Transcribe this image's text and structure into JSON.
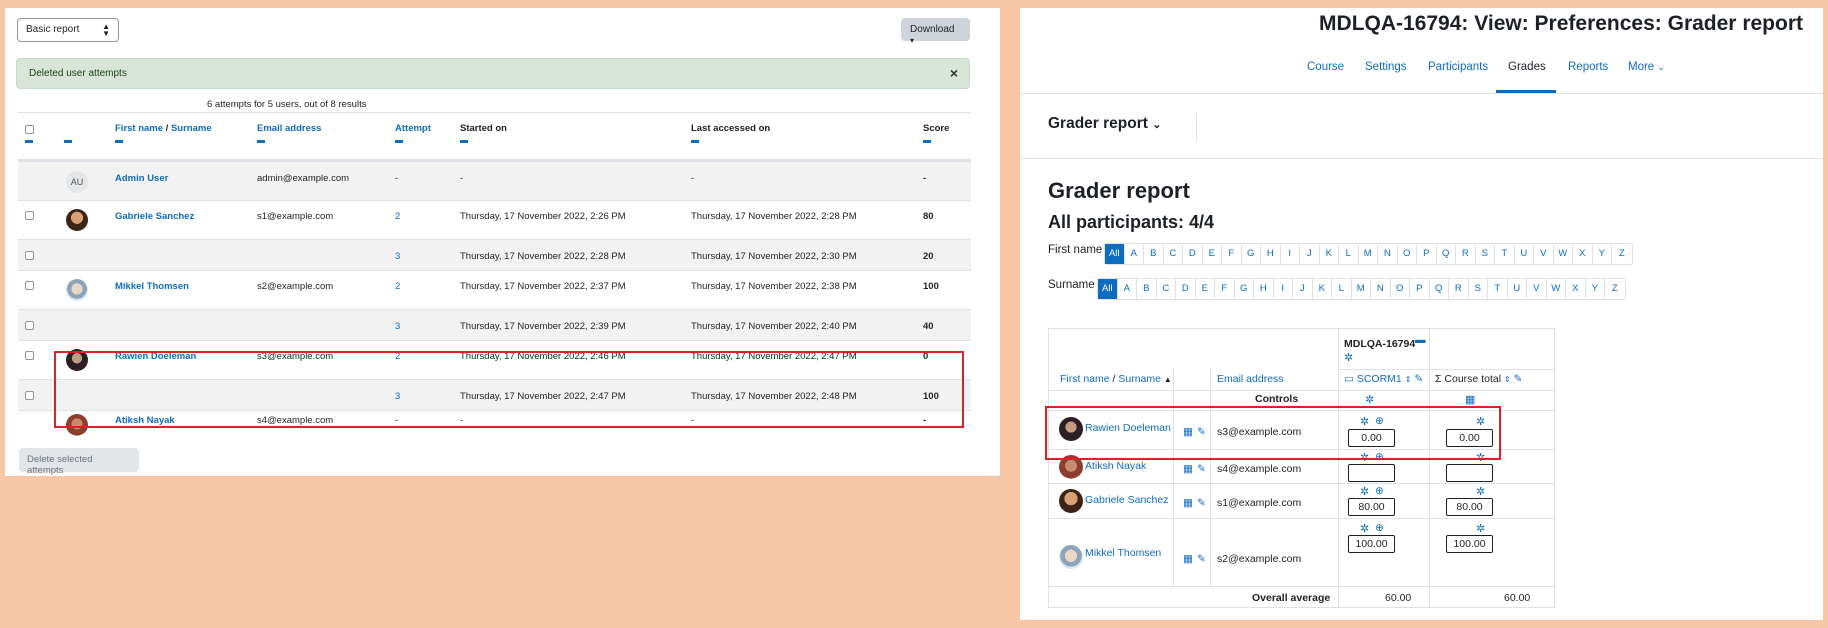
{
  "left": {
    "report_select": "Basic report",
    "download_label": "Download",
    "alert_text": "Deleted user attempts",
    "alert_close": "×",
    "results_note": "6 attempts for 5 users, out of 8 results",
    "headers": {
      "first_name": "First name",
      "slash": " / ",
      "surname": "Surname",
      "email": "Email address",
      "attempt": "Attempt",
      "started": "Started on",
      "last_accessed": "Last accessed on",
      "score": "Score"
    },
    "rows": [
      {
        "avatar": "AU",
        "name": "Admin User",
        "email": "admin@example.com",
        "attempt": "-",
        "started": "-",
        "last": "-",
        "score": "-"
      },
      {
        "name": "Gabriele Sanchez",
        "email": "s1@example.com",
        "attempt": "2",
        "started": "Thursday, 17 November 2022, 2:26 PM",
        "last": "Thursday, 17 November 2022, 2:28 PM",
        "score": "80"
      },
      {
        "name": "",
        "email": "",
        "attempt": "3",
        "started": "Thursday, 17 November 2022, 2:28 PM",
        "last": "Thursday, 17 November 2022, 2:30 PM",
        "score": "20"
      },
      {
        "name": "Mikkel Thomsen",
        "email": "s2@example.com",
        "attempt": "2",
        "started": "Thursday, 17 November 2022, 2:37 PM",
        "last": "Thursday, 17 November 2022, 2:38 PM",
        "score": "100"
      },
      {
        "name": "",
        "email": "",
        "attempt": "3",
        "started": "Thursday, 17 November 2022, 2:39 PM",
        "last": "Thursday, 17 November 2022, 2:40 PM",
        "score": "40"
      },
      {
        "name": "Rawien Doeleman",
        "email": "s3@example.com",
        "attempt": "2",
        "started": "Thursday, 17 November 2022, 2:46 PM",
        "last": "Thursday, 17 November 2022, 2:47 PM",
        "score": "0"
      },
      {
        "name": "",
        "email": "",
        "attempt": "3",
        "started": "Thursday, 17 November 2022, 2:47 PM",
        "last": "Thursday, 17 November 2022, 2:48 PM",
        "score": "100"
      },
      {
        "name": "Atiksh Nayak",
        "email": "s4@example.com",
        "attempt": "-",
        "started": "-",
        "last": "-",
        "score": "-"
      }
    ],
    "delete_button": "Delete selected attempts"
  },
  "right": {
    "course_title": "MDLQA-16794: View: Preferences: Grader report",
    "nav": [
      "Course",
      "Settings",
      "Participants",
      "Grades",
      "Reports",
      "More"
    ],
    "report_selector": "Grader report",
    "heading": "Grader report",
    "participants": "All participants: 4/4",
    "first_name_label": "First name",
    "surname_label": "Surname",
    "initials": [
      "All",
      "A",
      "B",
      "C",
      "D",
      "E",
      "F",
      "G",
      "H",
      "I",
      "J",
      "K",
      "L",
      "M",
      "N",
      "O",
      "P",
      "Q",
      "R",
      "S",
      "T",
      "U",
      "V",
      "W",
      "X",
      "Y",
      "Z"
    ],
    "table": {
      "category": "MDLQA-16794",
      "col_first": "First name",
      "col_slash": " / ",
      "col_surname": "Surname",
      "col_email": "Email address",
      "col_scorm": "SCORM1",
      "col_total": "Course total",
      "controls": "Controls",
      "rows": [
        {
          "name": "Rawien Doeleman",
          "email": "s3@example.com",
          "scorm": "0.00",
          "total": "0.00"
        },
        {
          "name": "Atiksh Nayak",
          "email": "s4@example.com",
          "scorm": "",
          "total": ""
        },
        {
          "name": "Gabriele Sanchez",
          "email": "s1@example.com",
          "scorm": "80.00",
          "total": "80.00"
        },
        {
          "name": "Mikkel Thomsen",
          "email": "s2@example.com",
          "scorm": "100.00",
          "total": "100.00"
        }
      ],
      "overall_label": "Overall average",
      "overall_scorm": "60.00",
      "overall_total": "60.00"
    }
  },
  "colors": {
    "accent": "#0f6cbf",
    "highlight": "#d9232a",
    "background": "#f8c7a8"
  }
}
